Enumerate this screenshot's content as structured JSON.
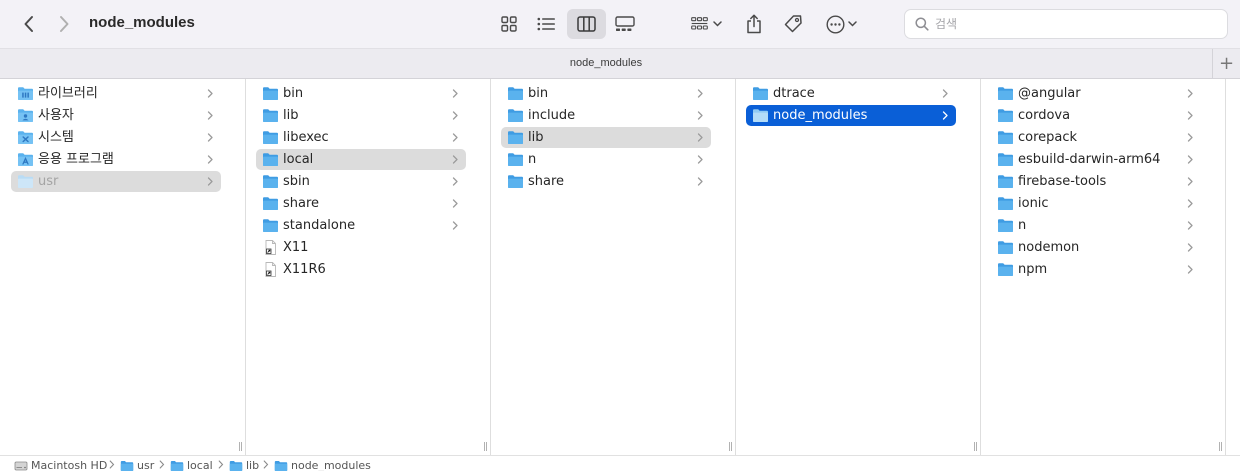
{
  "window": {
    "title": "node_modules",
    "tab_title": "node_modules",
    "tab_add": "+"
  },
  "toolbar": {
    "back": "chevron-left-icon",
    "forward": "chevron-right-icon",
    "views": [
      "icon-view",
      "list-view",
      "column-view",
      "gallery-view"
    ],
    "active_view": "column-view",
    "actions": [
      "group-icon",
      "share-icon",
      "tag-icon",
      "more-icon"
    ]
  },
  "search": {
    "placeholder": "검색"
  },
  "colors": {
    "selection_blue": "#0a5fd7",
    "selection_gray": "#dcdcdc",
    "folder": "#5ab2ee",
    "folder_dark": "#3f9ce3"
  },
  "columns": [
    {
      "items": [
        {
          "label": "라이브러리",
          "icon": "library-folder-icon"
        },
        {
          "label": "사용자",
          "icon": "users-folder-icon"
        },
        {
          "label": "시스템",
          "icon": "system-folder-icon"
        },
        {
          "label": "응용 프로그램",
          "icon": "applications-folder-icon"
        },
        {
          "label": "usr",
          "icon": "folder-icon"
        }
      ]
    },
    {
      "items": [
        {
          "label": "bin"
        },
        {
          "label": "lib"
        },
        {
          "label": "libexec"
        },
        {
          "label": "local"
        },
        {
          "label": "sbin"
        },
        {
          "label": "share"
        },
        {
          "label": "standalone"
        },
        {
          "label": "X11"
        },
        {
          "label": "X11R6"
        }
      ]
    },
    {
      "items": [
        {
          "label": "bin"
        },
        {
          "label": "include"
        },
        {
          "label": "lib"
        },
        {
          "label": "n"
        },
        {
          "label": "share"
        }
      ]
    },
    {
      "items": [
        {
          "label": "dtrace"
        },
        {
          "label": "node_modules"
        }
      ]
    },
    {
      "items": [
        {
          "label": "@angular"
        },
        {
          "label": "cordova"
        },
        {
          "label": "corepack"
        },
        {
          "label": "esbuild-darwin-arm64"
        },
        {
          "label": "firebase-tools"
        },
        {
          "label": "ionic"
        },
        {
          "label": "n"
        },
        {
          "label": "nodemon"
        },
        {
          "label": "npm"
        }
      ]
    }
  ],
  "resize_glyph": "||",
  "pathbar": [
    {
      "label": "Macintosh HD",
      "icon": "hard-drive-icon"
    },
    {
      "label": "usr",
      "icon": "folder-icon"
    },
    {
      "label": "local",
      "icon": "folder-icon"
    },
    {
      "label": "lib",
      "icon": "folder-icon"
    },
    {
      "label": "node_modules",
      "icon": "folder-icon"
    }
  ]
}
